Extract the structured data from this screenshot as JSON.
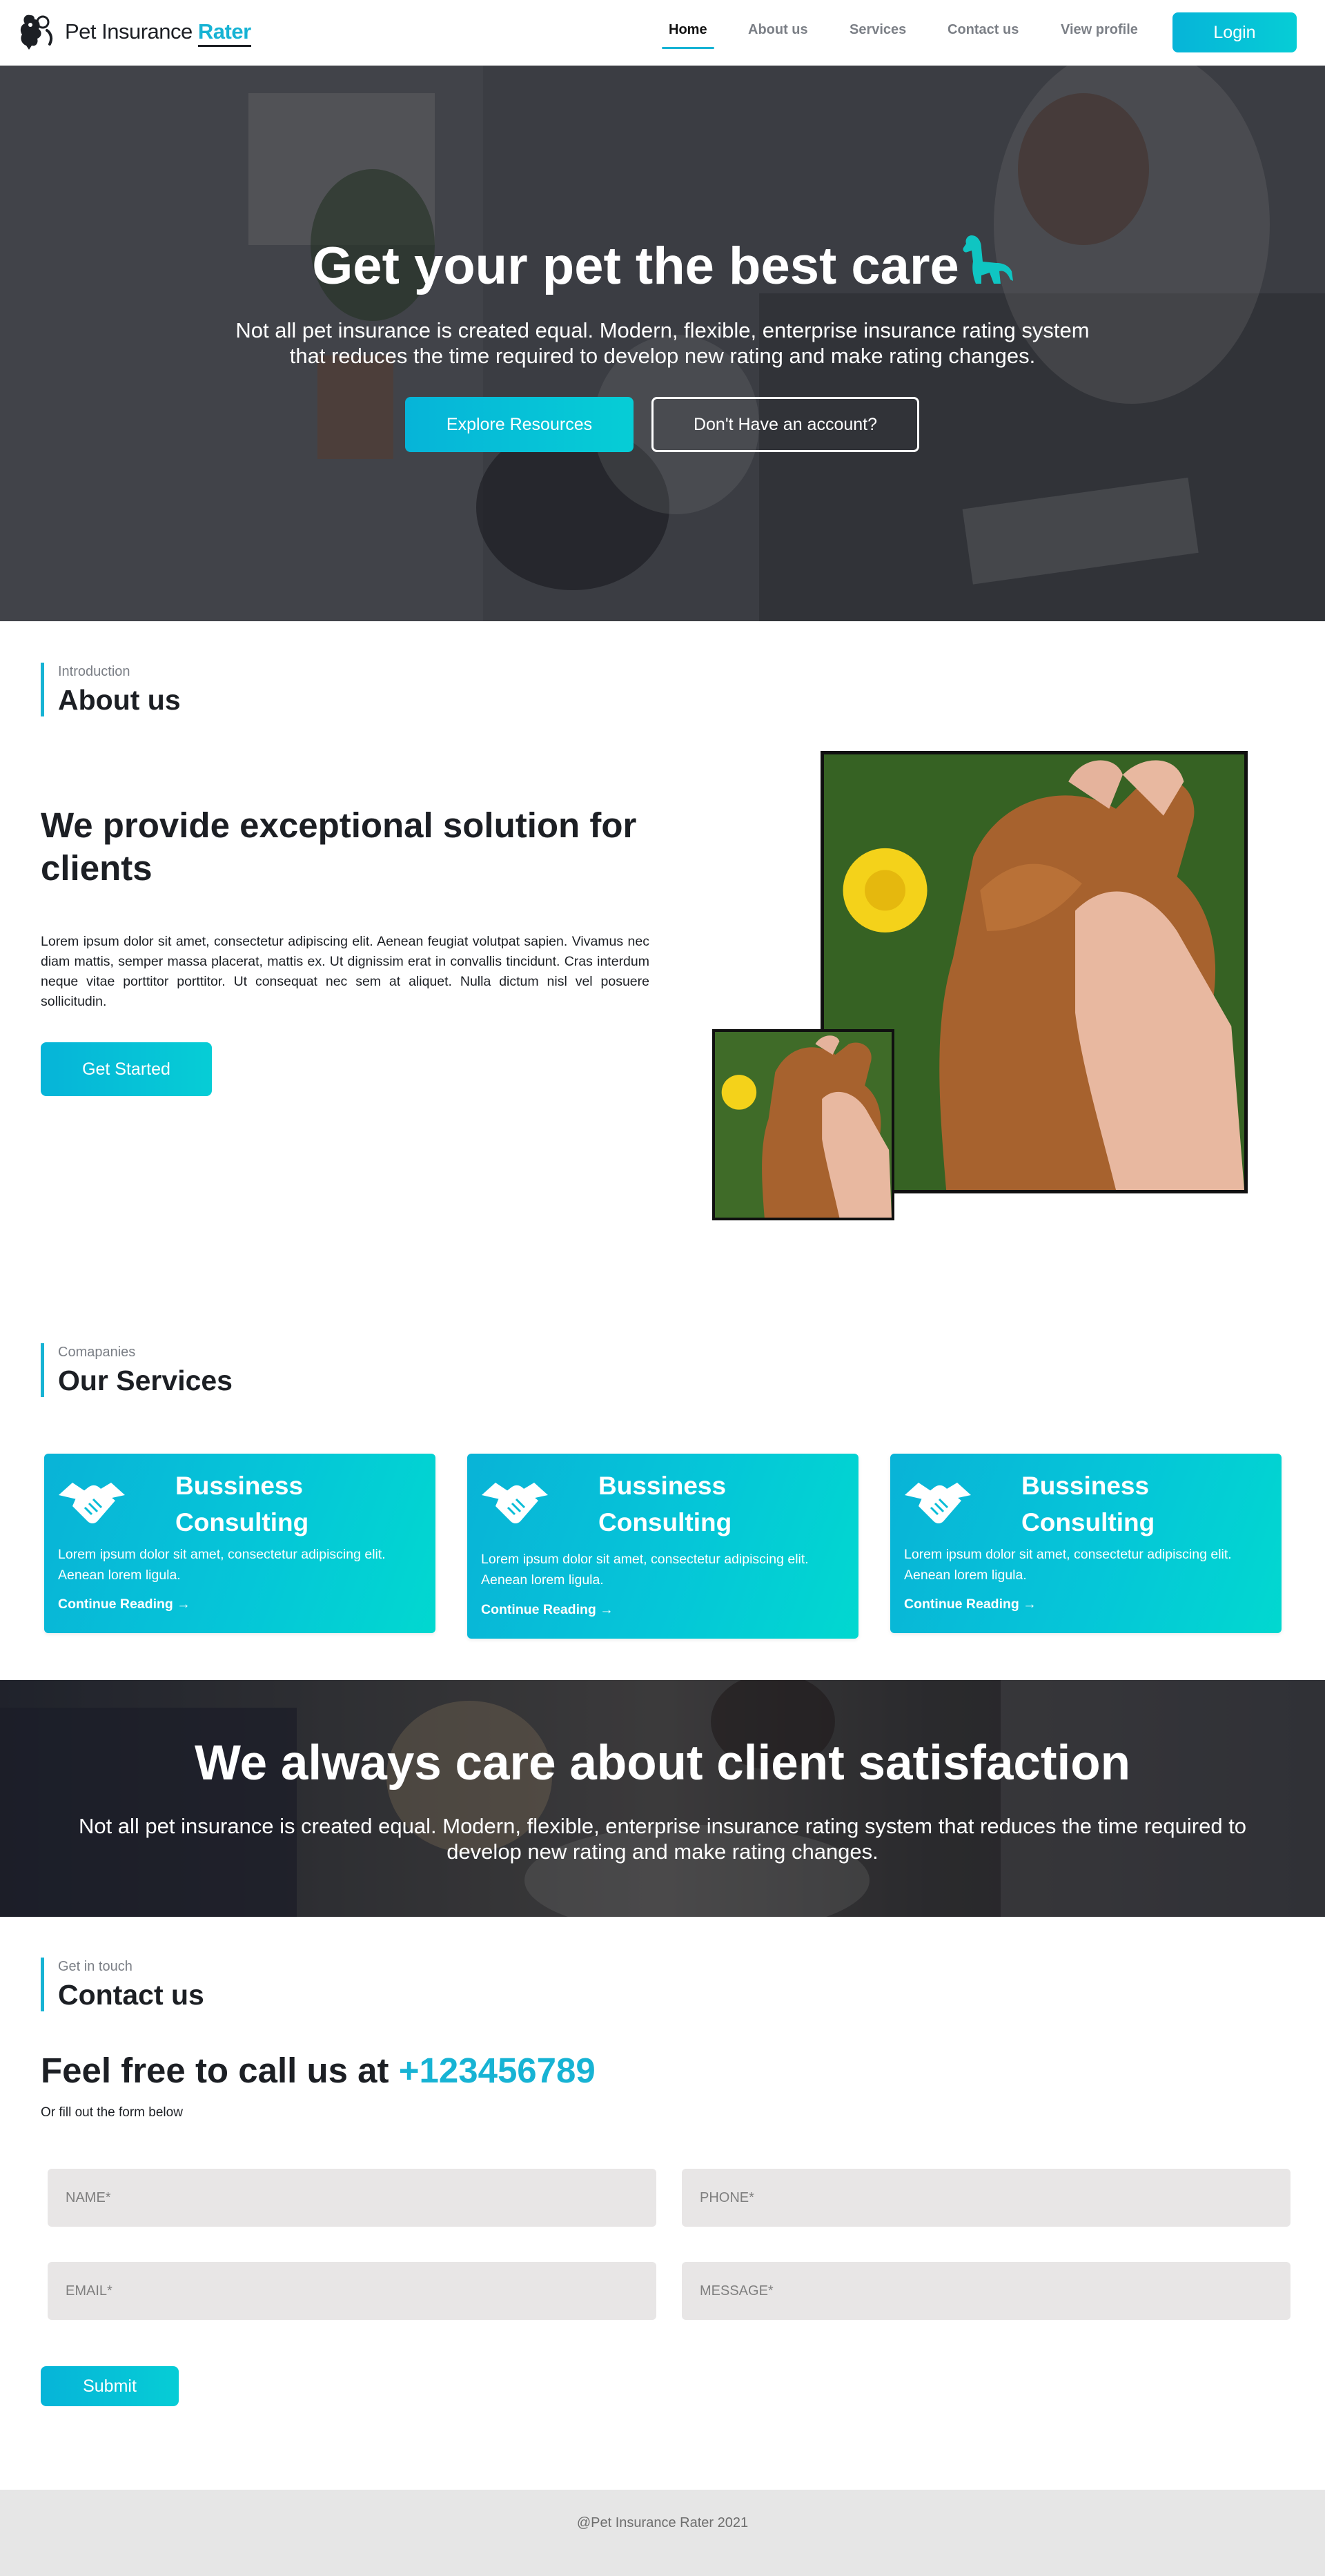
{
  "brand": {
    "name_part1": "Pet Insurance",
    "name_part2": "Rater",
    "accent_color": "#17b3d4",
    "gradient_start": "#06b4d8",
    "gradient_end": "#06cdd6"
  },
  "nav": {
    "items": [
      {
        "label": "Home",
        "active": true
      },
      {
        "label": "About us",
        "active": false
      },
      {
        "label": "Services",
        "active": false
      },
      {
        "label": "Contact us",
        "active": false
      },
      {
        "label": "View profile",
        "active": false
      }
    ],
    "login_label": "Login"
  },
  "hero": {
    "title": "Get your pet the best care",
    "subtitle": "Not all pet insurance is created equal. Modern, flexible, enterprise insurance rating system that reduces the time required to develop new rating and make rating changes.",
    "primary_button": "Explore Resources",
    "secondary_button": "Don't Have an account?",
    "title_icon": "dog-icon"
  },
  "about": {
    "eyebrow": "Introduction",
    "heading": "About us",
    "title": "We provide exceptional solution for clients",
    "text": "Lorem ipsum dolor sit amet, consectetur adipiscing elit. Aenean feugiat volutpat sapien. Vivamus nec diam mattis, semper massa placerat, mattis ex. Ut dignissim erat in convallis tincidunt. Cras interdum neque vitae porttitor porttitor. Ut consequat nec sem at aliquet. Nulla dictum nisl vel posuere sollicitudin.",
    "button": "Get Started",
    "image_icon": "paw-in-hand-image"
  },
  "services": {
    "eyebrow": "Comapanies",
    "heading": "Our Services",
    "cards": [
      {
        "title_line1": "Bussiness",
        "title_line2": "Consulting",
        "text": "Lorem ipsum dolor sit amet, consectetur adipiscing elit. Aenean lorem ligula.",
        "link": "Continue Reading →",
        "icon": "handshake-icon"
      },
      {
        "title_line1": "Bussiness",
        "title_line2": "Consulting",
        "text": "Lorem ipsum dolor sit amet, consectetur adipiscing elit. Aenean lorem ligula.",
        "link": "Continue Reading →",
        "icon": "handshake-icon"
      },
      {
        "title_line1": "Bussiness",
        "title_line2": "Consulting",
        "text": "Lorem ipsum dolor sit amet, consectetur adipiscing elit. Aenean lorem ligula.",
        "link": "Continue Reading →",
        "icon": "handshake-icon"
      }
    ]
  },
  "banner": {
    "title": "We always care about client satisfaction",
    "subtitle": "Not all pet insurance is created equal. Modern, flexible, enterprise insurance rating system that reduces the time required to develop new rating and make rating changes."
  },
  "contact": {
    "eyebrow": "Get in touch",
    "heading": "Contact us",
    "call_prefix": "Feel free to call us at",
    "phone": "+123456789",
    "call_sub": "Or fill out the form below",
    "fields": {
      "name_placeholder": "NAME*",
      "phone_placeholder": "PHONE*",
      "email_placeholder": "EMAIL*",
      "message_placeholder": "MESSAGE*",
      "name_value": "",
      "phone_value": "",
      "email_value": "",
      "message_value": ""
    },
    "submit": "Submit"
  },
  "footer": {
    "text": "@Pet Insurance Rater 2021"
  }
}
